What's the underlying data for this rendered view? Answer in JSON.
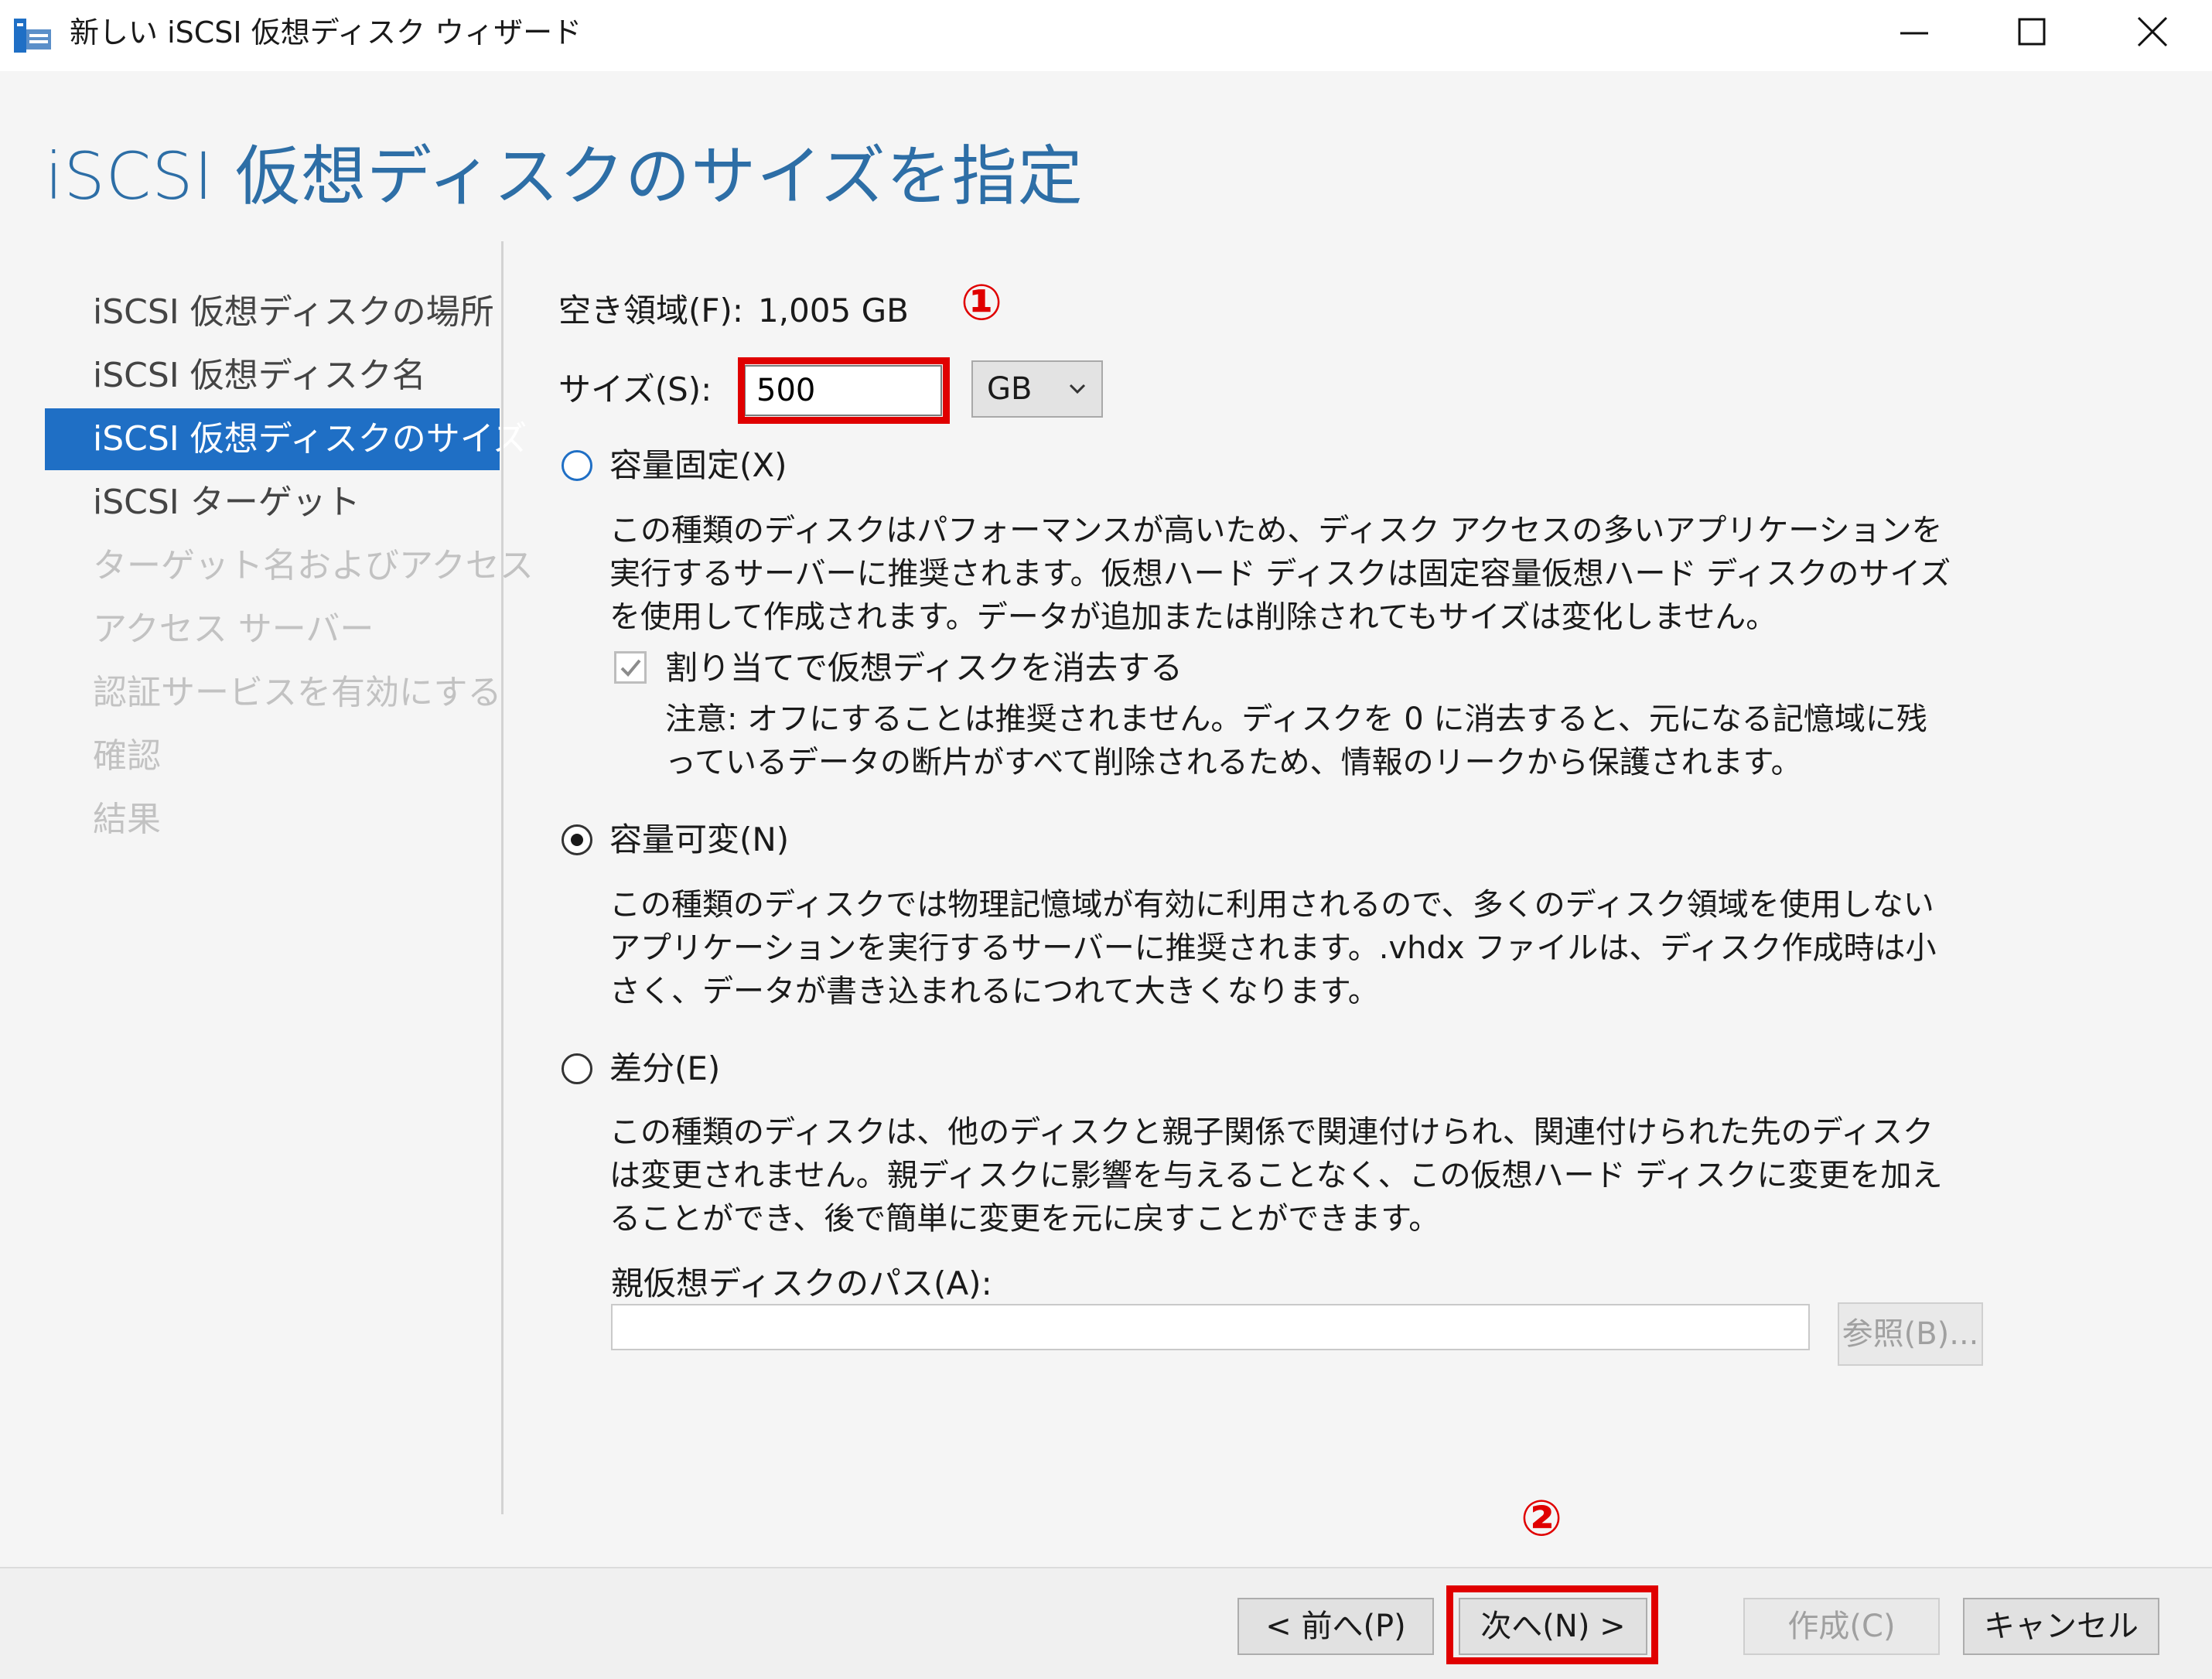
{
  "window": {
    "title": "新しい iSCSI 仮想ディスク ウィザード",
    "minimize_icon": "minimize-icon",
    "maximize_icon": "maximize-icon",
    "close_icon": "close-icon"
  },
  "page": {
    "title": "iSCSI 仮想ディスクのサイズを指定"
  },
  "nav": {
    "items": [
      {
        "label": "iSCSI 仮想ディスクの場所",
        "state": "done"
      },
      {
        "label": "iSCSI 仮想ディスク名",
        "state": "done"
      },
      {
        "label": "iSCSI 仮想ディスクのサイズ",
        "state": "active"
      },
      {
        "label": "iSCSI ターゲット",
        "state": "done"
      },
      {
        "label": "ターゲット名およびアクセス",
        "state": "disabled"
      },
      {
        "label": "アクセス サーバー",
        "state": "disabled"
      },
      {
        "label": "認証サービスを有効にする",
        "state": "disabled"
      },
      {
        "label": "確認",
        "state": "disabled"
      },
      {
        "label": "結果",
        "state": "disabled"
      }
    ]
  },
  "content": {
    "free_space_label": "空き領域(F):",
    "free_space_value": "1,005 GB",
    "size_label": "サイズ(S):",
    "size_value": "500",
    "unit_value": "GB",
    "fixed": {
      "label": "容量固定(X)",
      "checked": false,
      "description": "この種類のディスクはパフォーマンスが高いため、ディスク アクセスの多いアプリケーションを実行するサーバーに推奨されます。仮想ハード ディスクは固定容量仮想ハード ディスクのサイズを使用して作成されます。データが追加または削除されてもサイズは変化しません。",
      "clear_checkbox_label": "割り当てで仮想ディスクを消去する",
      "clear_checkbox_checked": true,
      "clear_note": "注意: オフにすることは推奨されません。ディスクを 0 に消去すると、元になる記憶域に残っているデータの断片がすべて削除されるため、情報のリークから保護されます。"
    },
    "dynamic": {
      "label": "容量可変(N)",
      "checked": true,
      "description": "この種類のディスクでは物理記憶域が有効に利用されるので、多くのディスク領域を使用しないアプリケーションを実行するサーバーに推奨されます。.vhdx ファイルは、ディスク作成時は小さく、データが書き込まれるにつれて大きくなります。"
    },
    "differencing": {
      "label": "差分(E)",
      "checked": false,
      "description": "この種類のディスクは、他のディスクと親子関係で関連付けられ、関連付けられた先のディスクは変更されません。親ディスクに影響を与えることなく、この仮想ハード ディスクに変更を加えることができ、後で簡単に変更を元に戻すことができます。",
      "parent_path_label": "親仮想ディスクのパス(A):",
      "parent_path_value": "",
      "browse_label": "参照(B)..."
    }
  },
  "annotations": {
    "marker1": "①",
    "marker2": "②",
    "highlight_color": "#e00000"
  },
  "footer": {
    "prev_label": "< 前へ(P)",
    "next_label": "次へ(N) >",
    "create_label": "作成(C)",
    "cancel_label": "キャンセル"
  },
  "colors": {
    "accent": "#1f6fc5",
    "title": "#2d6ea6"
  }
}
